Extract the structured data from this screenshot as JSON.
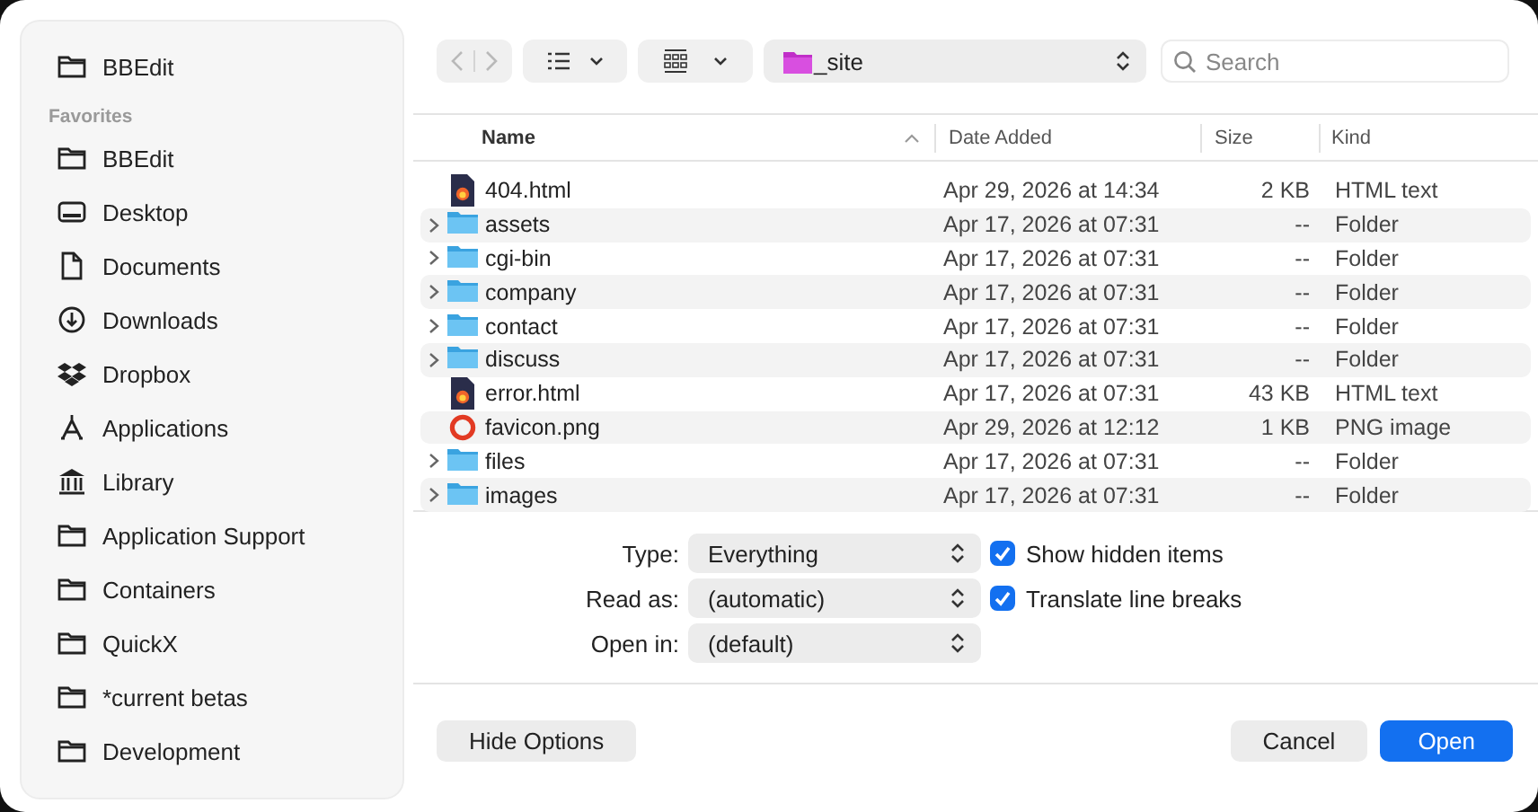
{
  "sidebar": {
    "top_item": {
      "label": "BBEdit",
      "kind": "folder"
    },
    "section_title": "Favorites",
    "items": [
      {
        "label": "BBEdit",
        "kind": "folder"
      },
      {
        "label": "Desktop",
        "kind": "desktop"
      },
      {
        "label": "Documents",
        "kind": "document"
      },
      {
        "label": "Downloads",
        "kind": "download"
      },
      {
        "label": "Dropbox",
        "kind": "dropbox"
      },
      {
        "label": "Applications",
        "kind": "apps"
      },
      {
        "label": "Library",
        "kind": "library"
      },
      {
        "label": "Application Support",
        "kind": "folder"
      },
      {
        "label": "Containers",
        "kind": "folder"
      },
      {
        "label": "QuickX",
        "kind": "folder"
      },
      {
        "label": "*current betas",
        "kind": "folder"
      },
      {
        "label": "Development",
        "kind": "folder"
      }
    ]
  },
  "toolbar": {
    "location": "_site",
    "search": {
      "placeholder": "Search"
    }
  },
  "table": {
    "columns": [
      "Name",
      "Date Added",
      "Size",
      "Kind"
    ],
    "rows": [
      {
        "name": "404.html",
        "kind": "html",
        "date": "Apr 29, 2026 at 14:34",
        "size": "2 KB",
        "type": "HTML text"
      },
      {
        "name": "assets",
        "kind": "folder",
        "date": "Apr 17, 2026 at 07:31",
        "size": "--",
        "type": "Folder"
      },
      {
        "name": "cgi-bin",
        "kind": "folder",
        "date": "Apr 17, 2026 at 07:31",
        "size": "--",
        "type": "Folder"
      },
      {
        "name": "company",
        "kind": "folder",
        "date": "Apr 17, 2026 at 07:31",
        "size": "--",
        "type": "Folder"
      },
      {
        "name": "contact",
        "kind": "folder",
        "date": "Apr 17, 2026 at 07:31",
        "size": "--",
        "type": "Folder"
      },
      {
        "name": "discuss",
        "kind": "folder",
        "date": "Apr 17, 2026 at 07:31",
        "size": "--",
        "type": "Folder"
      },
      {
        "name": "error.html",
        "kind": "html",
        "date": "Apr 17, 2026 at 07:31",
        "size": "43 KB",
        "type": "HTML text"
      },
      {
        "name": "favicon.png",
        "kind": "png",
        "date": "Apr 29, 2026 at 12:12",
        "size": "1 KB",
        "type": "PNG image"
      },
      {
        "name": "files",
        "kind": "folder",
        "date": "Apr 17, 2026 at 07:31",
        "size": "--",
        "type": "Folder"
      },
      {
        "name": "images",
        "kind": "folder",
        "date": "Apr 17, 2026 at 07:31",
        "size": "--",
        "type": "Folder"
      }
    ]
  },
  "options": [
    {
      "label": "Type:",
      "value": "Everything",
      "checkbox": {
        "label": "Show hidden items",
        "checked": true
      }
    },
    {
      "label": "Read as:",
      "value": "(automatic)",
      "checkbox": {
        "label": "Translate line breaks",
        "checked": true
      }
    },
    {
      "label": "Open in:",
      "value": "(default)"
    }
  ],
  "buttons": {
    "hide_options": "Hide Options",
    "cancel": "Cancel",
    "open": "Open"
  }
}
